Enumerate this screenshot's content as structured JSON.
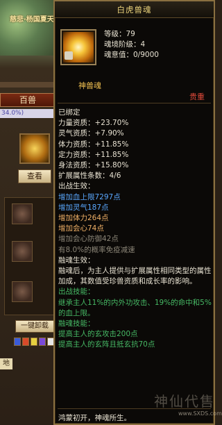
{
  "background": {
    "banner_text": "慈悲·杨国夏天",
    "tab_label": "百兽",
    "percent_label": "34.0%)",
    "view_button": "查看",
    "unload_button": "一键卸载",
    "ground_label": "地",
    "skill_colors": [
      "#3a5bd8",
      "#d84a2a",
      "#e6d040",
      "#7a4ad8",
      "#e8e8e8"
    ]
  },
  "tooltip": {
    "title": "白虎兽魂",
    "stats": [
      "等级：79",
      "魂境阶级：4",
      "魂意值：0/9000"
    ],
    "item_type": "神兽魂",
    "rarity": "贵重",
    "bound": "已绑定",
    "attributes": [
      "力量资质：+23.70%",
      "灵气资质：+7.90%",
      "体力资质：+11.85%",
      "定力资质：+11.85%",
      "身法资质：+15.80%",
      "扩展属性条数：4/6"
    ],
    "combat_effect_header": "出战生效：",
    "combat_effects": [
      {
        "text": "增加血上限7297点",
        "color": "blue"
      },
      {
        "text": "增加灵气187点",
        "color": "blue"
      },
      {
        "text": "增加体力264点",
        "color": "orange"
      },
      {
        "text": "增加会心74点",
        "color": "orange"
      },
      {
        "text": "增加会心防御42点",
        "color": "gray"
      },
      {
        "text": "有8.0%的概率免疫减速",
        "color": "gray"
      }
    ],
    "fusion_effect_header": "融魂生效：",
    "fusion_effect_desc": "融魂后，为主人提供与扩展属性相同类型的属性加成，其数值受珍兽资质和成长率的影响。",
    "combat_skill_header": "出战技能：",
    "combat_skill_desc": "继承主人11%的内外功攻击、19%的命中和5%的血上限。",
    "fusion_skill_header": "融魂技能：",
    "fusion_skills": [
      "提高主人的玄攻击200点",
      "提高主人的玄阵且抵玄抗70点"
    ],
    "footer": "鸿蒙初开，神魂所生。",
    "watermark": "神仙代售",
    "watermark_url": "www.SXDS.com"
  }
}
